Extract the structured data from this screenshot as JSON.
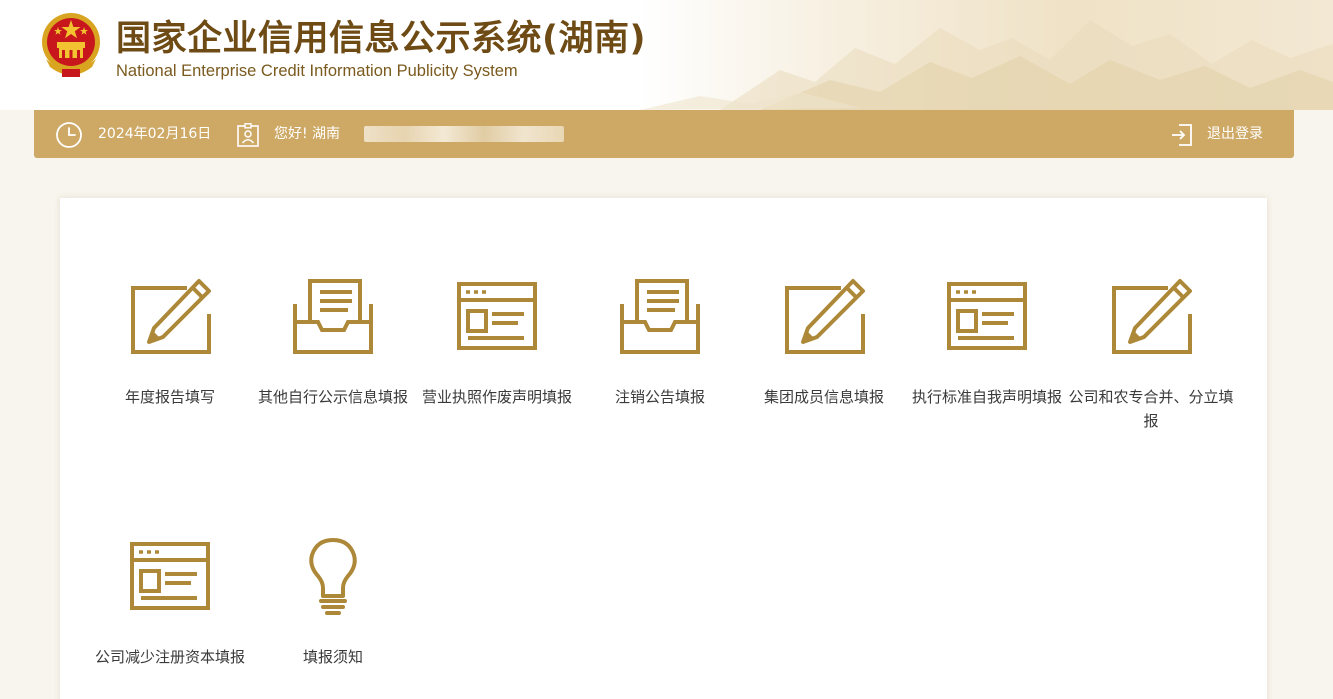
{
  "header": {
    "title_cn": "国家企业信用信息公示系统(湖南)",
    "title_en": "National Enterprise Credit Information Publicity System",
    "emblem_icon": "national-emblem-icon"
  },
  "topbar": {
    "date": "2024年02月16日",
    "greeting": "您好! 湖南",
    "logout_label": "退出登录",
    "clock_icon": "clock-icon",
    "user_icon": "user-card-icon",
    "logout_icon": "logout-icon"
  },
  "tiles": [
    {
      "label": "年度报告填写",
      "icon": "edit-icon"
    },
    {
      "label": "其他自行公示信息填报",
      "icon": "inbox-document-icon"
    },
    {
      "label": "营业执照作废声明填报",
      "icon": "browser-window-icon"
    },
    {
      "label": "注销公告填报",
      "icon": "inbox-document-icon"
    },
    {
      "label": "集团成员信息填报",
      "icon": "edit-icon"
    },
    {
      "label": "执行标准自我声明填报",
      "icon": "browser-window-icon"
    },
    {
      "label": "公司和农专合并、分立填报",
      "icon": "edit-icon"
    },
    {
      "label": "公司减少注册资本填报",
      "icon": "browser-window-icon"
    },
    {
      "label": "填报须知",
      "icon": "lightbulb-icon"
    }
  ],
  "colors": {
    "gold_bar": "#cea965",
    "icon_gold": "#ad8838",
    "title_brown": "#6e4a14",
    "page_bg": "#f8f5ee"
  }
}
